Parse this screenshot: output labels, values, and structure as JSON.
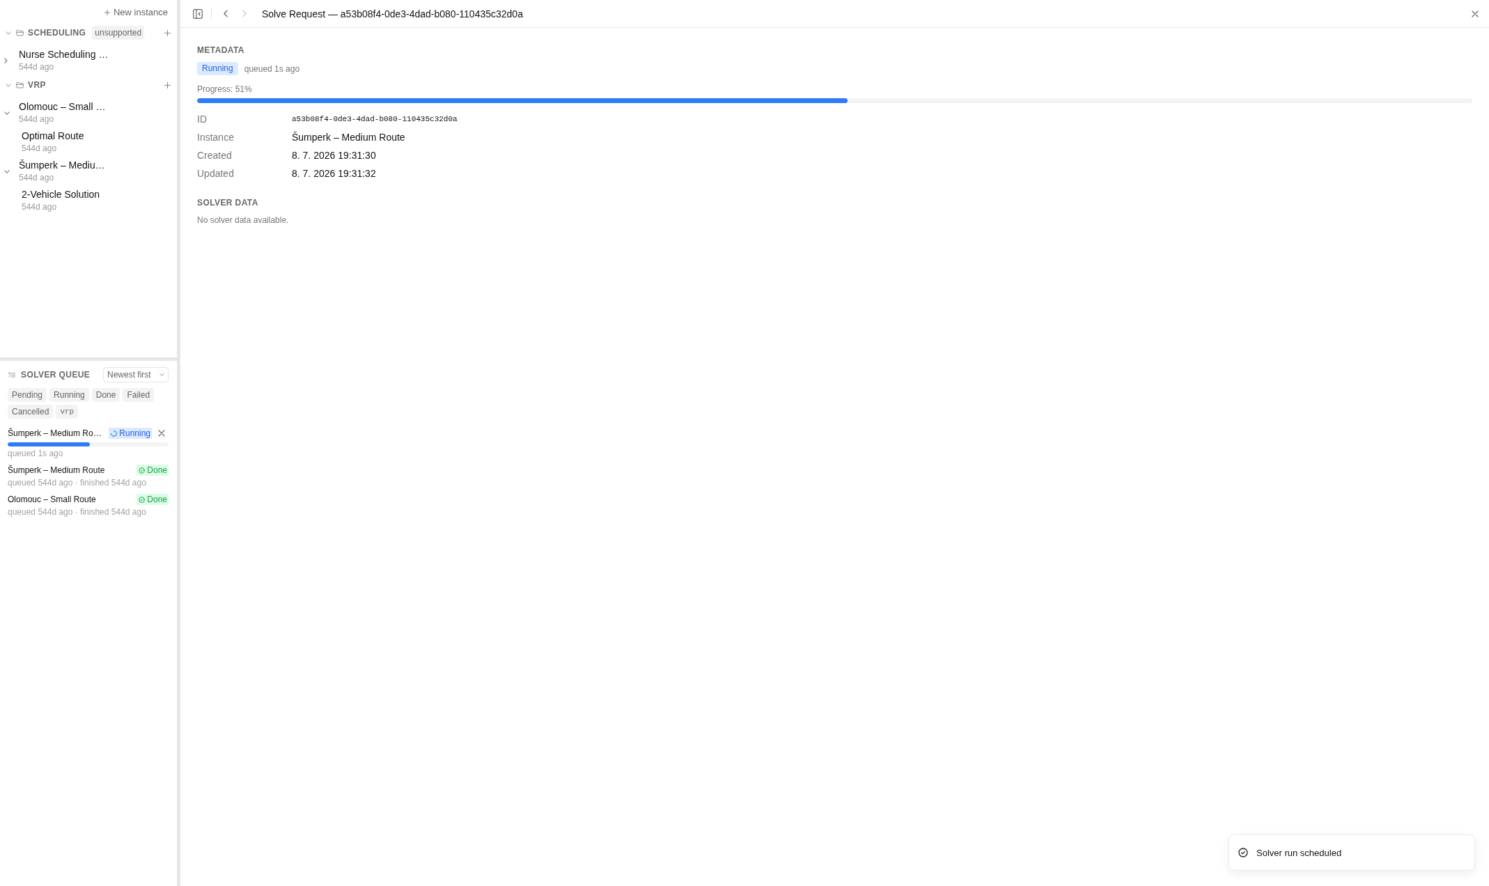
{
  "sidebar": {
    "new_instance_button": "New instance",
    "groups": [
      {
        "name": "SCHEDULING",
        "expanded": true,
        "badge": "unsupported",
        "instances": [
          {
            "title": "Nurse Scheduling …",
            "age": "544d ago",
            "expanded": false
          }
        ]
      },
      {
        "name": "VRP",
        "expanded": true,
        "instances": [
          {
            "title": "Olomouc – Small …",
            "age": "544d ago",
            "expanded": true,
            "children": [
              {
                "title": "Optimal Route",
                "age": "544d ago"
              }
            ]
          },
          {
            "title": "Šumperk – Mediu…",
            "age": "544d ago",
            "expanded": true,
            "children": [
              {
                "title": "2-Vehicle Solution",
                "age": "544d ago"
              }
            ]
          }
        ]
      }
    ]
  },
  "solver_queue": {
    "title": "SOLVER QUEUE",
    "sort": "Newest first",
    "filters": [
      {
        "label": "Pending",
        "kind": "status",
        "selected": false
      },
      {
        "label": "Running",
        "kind": "status",
        "selected": false
      },
      {
        "label": "Done",
        "kind": "status",
        "selected": false
      },
      {
        "label": "Failed",
        "kind": "status",
        "selected": false
      },
      {
        "label": "Cancelled",
        "kind": "status",
        "selected": false
      },
      {
        "label": "vrp",
        "kind": "tag",
        "selected": false
      }
    ],
    "items": [
      {
        "title": "Šumperk – Medium Ro…",
        "kind": "running",
        "status": "Running",
        "cancellable": true,
        "level": 0.51,
        "meta": "queued 1s ago"
      },
      {
        "title": "Šumperk – Medium Route",
        "kind": "done",
        "status": "Done",
        "cancellable": false,
        "meta": "queued 544d ago · finished 544d ago"
      },
      {
        "title": "Olomouc – Small Route",
        "kind": "done",
        "status": "Done",
        "cancellable": false,
        "meta": "queued 544d ago · finished 544d ago"
      }
    ]
  },
  "header": {
    "title": "Solve Request — a53b08f4-0de3-4dad-b080-110435c32d0a",
    "nav": [
      {
        "kind": "back",
        "disabled": false
      },
      {
        "kind": "forward",
        "disabled": true
      }
    ]
  },
  "metadata": {
    "heading": "METADATA",
    "status": {
      "label": "Running",
      "kind": "running"
    },
    "queued": "queued 1s ago",
    "progress_label": "Progress: 51%",
    "level": 0.51,
    "fields": [
      {
        "label": "ID",
        "value": "a53b08f4-0de3-4dad-b080-110435c32d0a",
        "kind": "mono"
      },
      {
        "label": "Instance",
        "value": "Šumperk – Medium Route",
        "kind": "text"
      },
      {
        "label": "Created",
        "value": "8. 7. 2026 19:31:30",
        "kind": "text"
      },
      {
        "label": "Updated",
        "value": "8. 7. 2026 19:31:32",
        "kind": "text"
      }
    ]
  },
  "solver_data": {
    "heading": "SOLVER DATA",
    "empty_message": "No solver data available."
  },
  "toast": {
    "message": "Solver run scheduled"
  }
}
